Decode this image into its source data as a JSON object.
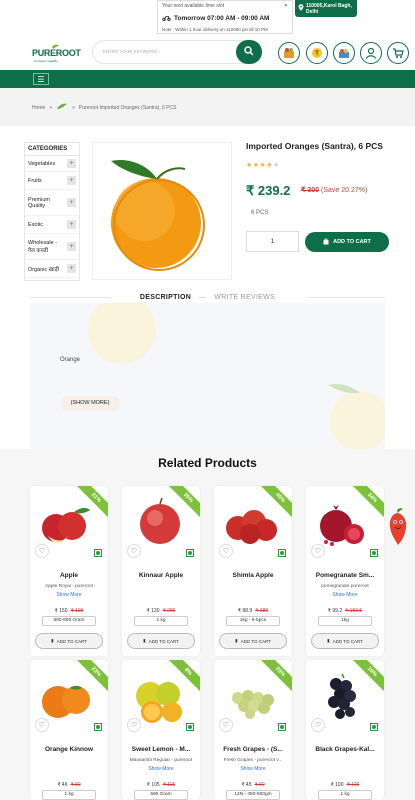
{
  "slot": {
    "label": "Your next available time slot",
    "day_time": "Tomorrow 07:00 AM - 09:00 AM",
    "note": "Note : Within 1 hour delivery on 110060 pin till 10 PM"
  },
  "location": {
    "text": "110005,Karol Bagh, Delhi"
  },
  "header": {
    "logo_text": "PUREROOT",
    "logo_sub": "Consume Healthy",
    "search_placeholder": "ENTER YOUR KEYWORD..."
  },
  "breadcrumb": {
    "home": "Home",
    "current": "Pureroot Imported Oranges (Santra), 6 PCS"
  },
  "categories": {
    "title": "CATEGORIES",
    "items": [
      {
        "label": "Vegetables"
      },
      {
        "label": "Fruits"
      },
      {
        "label": "Premium Quality"
      },
      {
        "label": "Exotic"
      },
      {
        "label": "Wholesale - गैल कपडी"
      },
      {
        "label": "Organic खाड़ी"
      }
    ]
  },
  "product": {
    "title": "Imported Oranges (Santra), 6 PCS",
    "rating": 4,
    "rating_max": 5,
    "price": "₹ 239.2",
    "mrp": "₹ 300",
    "save": "(Save 20.27%)",
    "unit": "6 PCS",
    "qty": "1",
    "add_to_cart": "ADD TO CART"
  },
  "tabs": {
    "description": "DESCRIPTION",
    "separator": "—",
    "reviews": "WRITE REVIEWS"
  },
  "description": {
    "text": "Orange",
    "show_more": "(SHOW MORE)"
  },
  "related": {
    "title": "Related Products",
    "items": [
      {
        "name": "Apple",
        "sub": "Apple Royal - pureroot",
        "show_more": "Show More",
        "price": "₹ 150",
        "mrp": "₹ 199",
        "weight": "500-600 Gram",
        "discount": "21%",
        "add": "ADD TO CART",
        "fruit": "apple"
      },
      {
        "name": "Kinnaur Apple",
        "sub": "",
        "show_more": "",
        "price": "₹ 130",
        "mrp": "₹ 200",
        "weight": "1 kg",
        "discount": "35%",
        "add": "ADD TO CART",
        "fruit": "apple2"
      },
      {
        "name": "Shimla Apple",
        "sub": "",
        "show_more": "",
        "price": "₹ 98.9",
        "mrp": "₹ 180",
        "weight": "1kg - 6-5pcs",
        "discount": "45%",
        "add": "ADD TO CART",
        "fruit": "apple3"
      },
      {
        "name": "Pomegranate Sm...",
        "sub": "pomegranate pureroot",
        "show_more": "Show More",
        "price": "₹ 99.2",
        "mrp": "₹ 150.5",
        "weight": "1kg",
        "discount": "34%",
        "add": "ADD TO CART",
        "fruit": "pome"
      },
      {
        "name": "Orange Kinnow",
        "sub": "",
        "show_more": "",
        "price": "₹ 46",
        "mrp": "₹ 60",
        "weight": "1 kg",
        "discount": "23%",
        "add": "ADD TO CART",
        "fruit": "orange"
      },
      {
        "name": "Sweet Lemon - M...",
        "sub": "Mausambi Regular - pureroot",
        "show_more": "Show More",
        "price": "₹ 105",
        "mrp": "₹ 115",
        "weight": "500 Gram",
        "discount": "8%",
        "add": "ADD TO CART",
        "fruit": "lemon"
      },
      {
        "name": "Fresh Grapes - (S...",
        "sub": "Fresh Grapes - pureroot v...",
        "show_more": "Show More",
        "price": "₹ 45",
        "mrp": "₹ 60",
        "weight": "12N - 450-500gm",
        "discount": "25%",
        "add": "ADD TO CART",
        "fruit": "grapes"
      },
      {
        "name": "Black Grapes-Kal...",
        "sub": "",
        "show_more": "",
        "price": "₹ 100",
        "mrp": "₹ 120",
        "weight": "1 kg",
        "discount": "16%",
        "add": "ADD TO CART",
        "fruit": "black"
      }
    ]
  },
  "colors": {
    "brand_green": "#0f6e4a",
    "ribbon_green": "#7cc03b",
    "price_red": "#d23c3c",
    "link_blue": "#2f6fd0"
  }
}
